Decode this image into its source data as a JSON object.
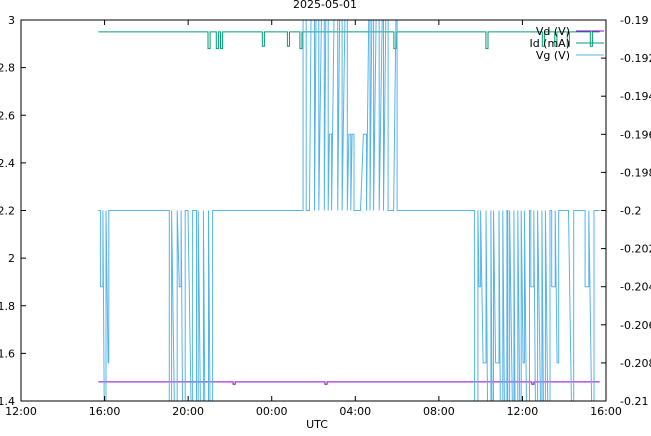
{
  "chart_data": {
    "type": "line",
    "title": "2025-05-01",
    "xlabel": "UTC",
    "x_ticks": [
      "12:00",
      "16:00",
      "20:00",
      "00:00",
      "04:00",
      "08:00",
      "12:00",
      "16:00"
    ],
    "x_range_hours": [
      -12,
      16
    ],
    "y_left": {
      "range": [
        1.4,
        3.0
      ],
      "ticks": [
        "1.4",
        "1.6",
        "1.8",
        "2",
        "2.2",
        "2.4",
        "2.6",
        "2.8",
        "3"
      ]
    },
    "y_right": {
      "range": [
        -0.21,
        -0.19
      ],
      "ticks": [
        "-0.21",
        "-0.208",
        "-0.206",
        "-0.204",
        "-0.202",
        "-0.2",
        "-0.198",
        "-0.196",
        "-0.194",
        "-0.192",
        "-0.19"
      ]
    },
    "legend_position": "top-right",
    "grid": false,
    "series": [
      {
        "name": "Vd (V)",
        "axis": "left",
        "color": "#9400d3",
        "x_start": -8.3,
        "x_end": 15.7,
        "baseline": 1.48,
        "dips": [
          [
            -1.8,
            1.47
          ],
          [
            2.6,
            1.47
          ],
          [
            12.5,
            1.47
          ]
        ]
      },
      {
        "name": "Id (mA)",
        "axis": "left",
        "color": "#009e73",
        "x_start": -8.3,
        "x_end": 15.7,
        "baseline": 2.95,
        "dips": [
          [
            -3.0,
            2.88
          ],
          [
            -2.6,
            2.88
          ],
          [
            -2.4,
            2.88
          ],
          [
            0.8,
            2.89
          ],
          [
            -0.4,
            2.89
          ],
          [
            1.4,
            2.88
          ],
          [
            5.9,
            2.88
          ],
          [
            10.3,
            2.88
          ],
          [
            13.0,
            2.89
          ],
          [
            13.6,
            2.89
          ],
          [
            14.2,
            2.89
          ],
          [
            15.3,
            2.89
          ]
        ]
      },
      {
        "name": "Vg (V)",
        "axis": "right",
        "color": "#56b4e9",
        "x_start": -8.3,
        "x_end": 15.7,
        "baseline": -0.2,
        "high": -0.19,
        "low": -0.21,
        "step_mid_high": -0.196,
        "step_mid_low": -0.204,
        "step_low_mid": -0.208,
        "segments_high": [
          [
            1.5,
            6.0
          ]
        ],
        "segments_low": [
          [
            -8.2,
            -7.8
          ],
          [
            -4.9,
            -3.7
          ],
          [
            -3.6,
            -2.8
          ],
          [
            9.7,
            11.3
          ],
          [
            11.3,
            12.4
          ],
          [
            12.4,
            13.4
          ],
          [
            13.4,
            14.7
          ],
          [
            15.0,
            15.5
          ]
        ]
      }
    ]
  }
}
